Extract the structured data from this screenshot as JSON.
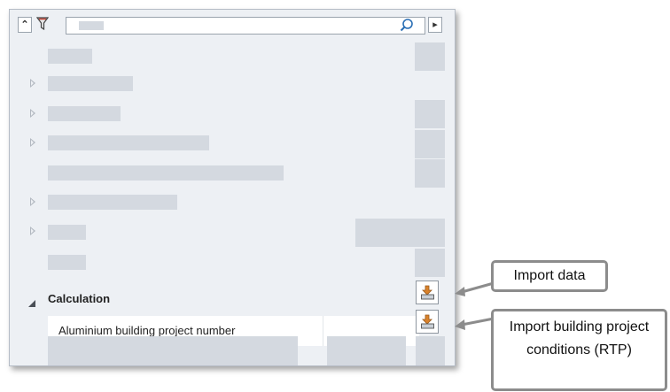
{
  "toolbar": {
    "collapse_icon": "chevron-up-icon",
    "collapse_glyph": "⌃",
    "filter_icon": "filter-icon",
    "search_icon": "search-icon",
    "more_icon": "chevron-right-icon",
    "more_glyph": "▸"
  },
  "section": {
    "label": "Calculation",
    "row_label": "Aluminium building project number"
  },
  "callouts": {
    "import_data": "Import data",
    "import_conditions": "Import building project conditions (RTP)"
  },
  "colors": {
    "panel_bg": "#edf0f4",
    "placeholder": "#d4d9e0",
    "callout_border": "#8c8c8c"
  }
}
